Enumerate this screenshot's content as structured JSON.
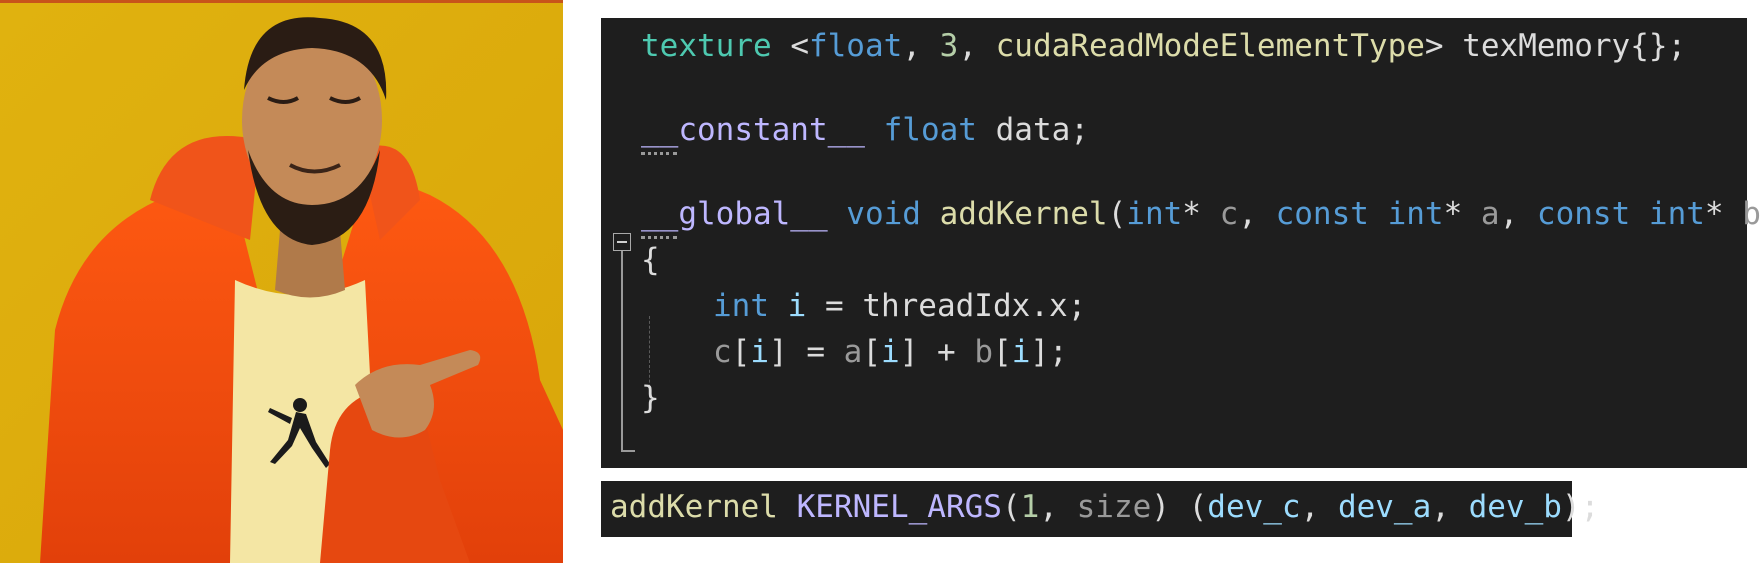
{
  "code": {
    "line1": {
      "kw": "texture",
      "open": " <",
      "type": "float",
      "sep1": ", ",
      "num": "3",
      "sep2": ", ",
      "mode": "cudaReadModeElementType",
      "close": "> texMemory{};"
    },
    "line2": {
      "qual": "__constant__",
      "type": " float",
      "rest": " data;"
    },
    "line3": {
      "qual": "__global__",
      "ret": " void ",
      "fn": "addKernel",
      "p0": "(",
      "t1": "int",
      "s1": "* ",
      "a1": "c",
      "s2": ", ",
      "k2": "const",
      "t2": " int",
      "s3": "* ",
      "a2": "a",
      "s4": ", ",
      "k3": "const",
      "t3": " int",
      "s5": "* ",
      "a3": "b",
      "p1": ")"
    },
    "open_brace": "{",
    "line5": {
      "type": "int",
      "var": " i",
      "rest": " = threadIdx.x;"
    },
    "line6": {
      "c": "c",
      "o1": "[",
      "i1": "i",
      "o2": "] = ",
      "a": "a",
      "o3": "[",
      "i2": "i",
      "o4": "] + ",
      "b": "b",
      "o5": "[",
      "i3": "i",
      "o6": "];"
    },
    "close_brace": "}"
  },
  "call": {
    "fn": "addKernel ",
    "macro": "KERNEL_ARGS",
    "p0": "(",
    "num": "1",
    "sep": ", ",
    "size": "size",
    "p1": ") (",
    "v1": "dev_c",
    "s1": ", ",
    "v2": "dev_a",
    "s2": ", ",
    "v3": "dev_b",
    "end": ");"
  }
}
